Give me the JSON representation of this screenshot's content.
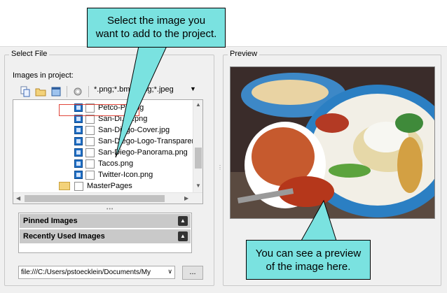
{
  "callouts": {
    "top_line1": "Select the image you",
    "top_line2": "want to add to the project.",
    "bottom_line1": "You can see a preview",
    "bottom_line2": "of the image here."
  },
  "select_file": {
    "group_title": "Select File",
    "images_label": "Images in project:",
    "filter": "*.png;*.bmp;*.jpg;*.jpeg",
    "tree_items": [
      {
        "label": "Petco-P...png",
        "type": "image"
      },
      {
        "label": "San-Di...g.png",
        "type": "image"
      },
      {
        "label": "San-Diego-Cover.jpg",
        "type": "image"
      },
      {
        "label": "San-Diego-Logo-Transparent",
        "type": "image"
      },
      {
        "label": "San-Diego-Panorama.png",
        "type": "image"
      },
      {
        "label": "Tacos.png",
        "type": "image",
        "selected": true
      },
      {
        "label": "Twitter-Icon.png",
        "type": "image"
      },
      {
        "label": "MasterPages",
        "type": "folder"
      }
    ],
    "pinned_label": "Pinned Images",
    "recent_label": "Recently Used Images",
    "path": "file:///C:/Users/pstoecklein/Documents/My",
    "browse_label": "..."
  },
  "preview": {
    "group_title": "Preview"
  },
  "colors": {
    "callout_fill": "#7ae2e0",
    "selection_outline": "#e0453a"
  }
}
